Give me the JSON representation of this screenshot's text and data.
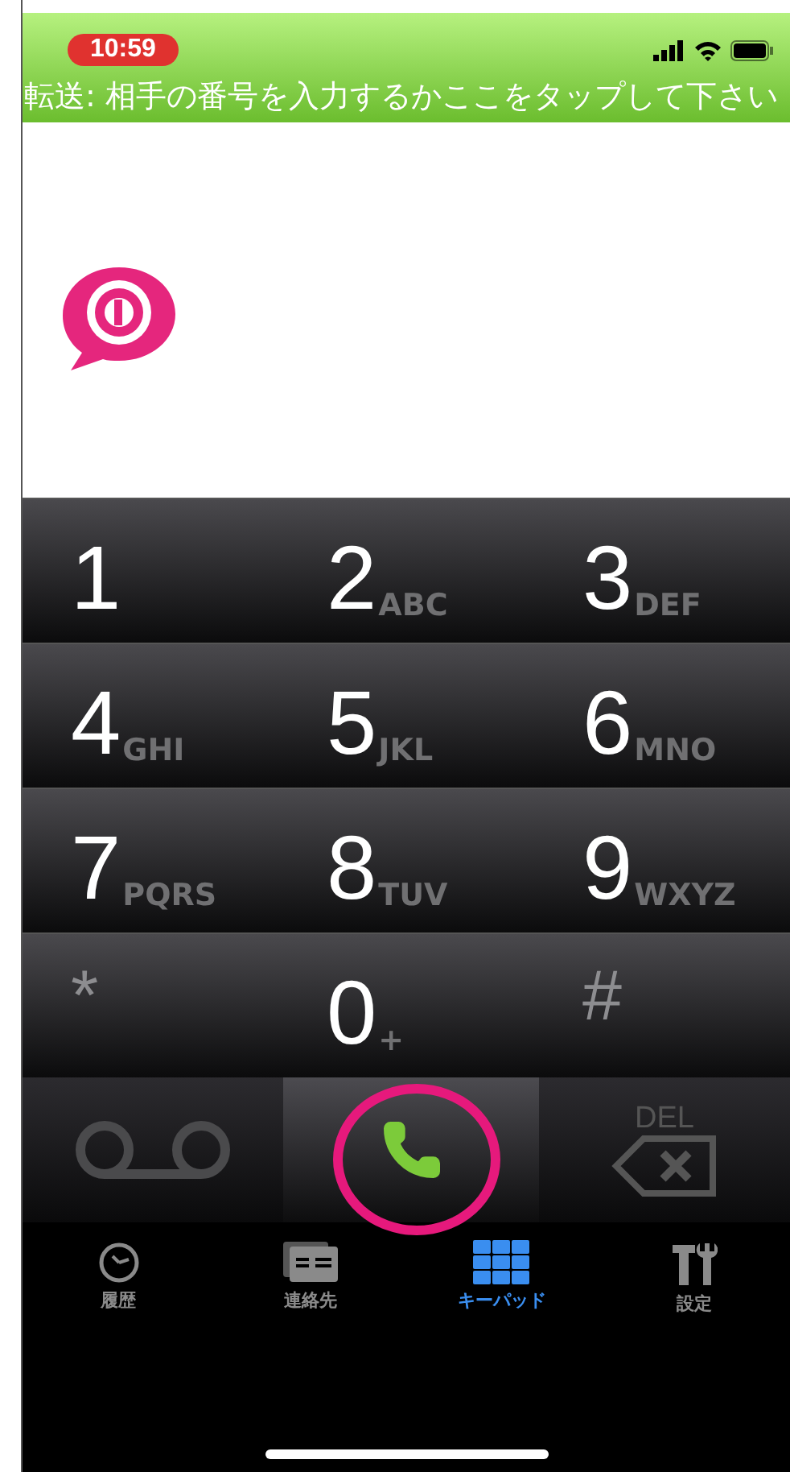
{
  "status_bar": {
    "time": "10:59"
  },
  "banner": {
    "text": "転送: 相手の番号を入力するかここをタップして下さい"
  },
  "keypad": [
    {
      "kind": "digit",
      "digit": "1"
    },
    {
      "kind": "digit",
      "digit": "2",
      "letters": "ABC"
    },
    {
      "kind": "digit",
      "digit": "3",
      "letters": "DEF"
    },
    {
      "kind": "digit",
      "digit": "4",
      "letters": "GHI"
    },
    {
      "kind": "digit",
      "digit": "5",
      "letters": "JKL"
    },
    {
      "kind": "digit",
      "digit": "6",
      "letters": "MNO"
    },
    {
      "kind": "digit",
      "digit": "7",
      "letters": "PQRS"
    },
    {
      "kind": "digit",
      "digit": "8",
      "letters": "TUV"
    },
    {
      "kind": "digit",
      "digit": "9",
      "letters": "WXYZ"
    },
    {
      "kind": "symbol",
      "digit": "*"
    },
    {
      "kind": "digit",
      "digit": "0",
      "letters": "+"
    },
    {
      "kind": "symbol",
      "digit": "#"
    }
  ],
  "actions": [
    {
      "kind": "voicemail",
      "highlighted": false
    },
    {
      "kind": "call",
      "highlighted": true
    },
    {
      "kind": "delete",
      "label": "DEL",
      "highlighted": false
    }
  ],
  "tabs": [
    {
      "kind": "history",
      "label": "履歴",
      "selected": false
    },
    {
      "kind": "contacts",
      "label": "連絡先",
      "selected": false
    },
    {
      "kind": "keypad",
      "label": "キーパッド",
      "selected": true
    },
    {
      "kind": "settings",
      "label": "設定",
      "selected": false
    }
  ]
}
